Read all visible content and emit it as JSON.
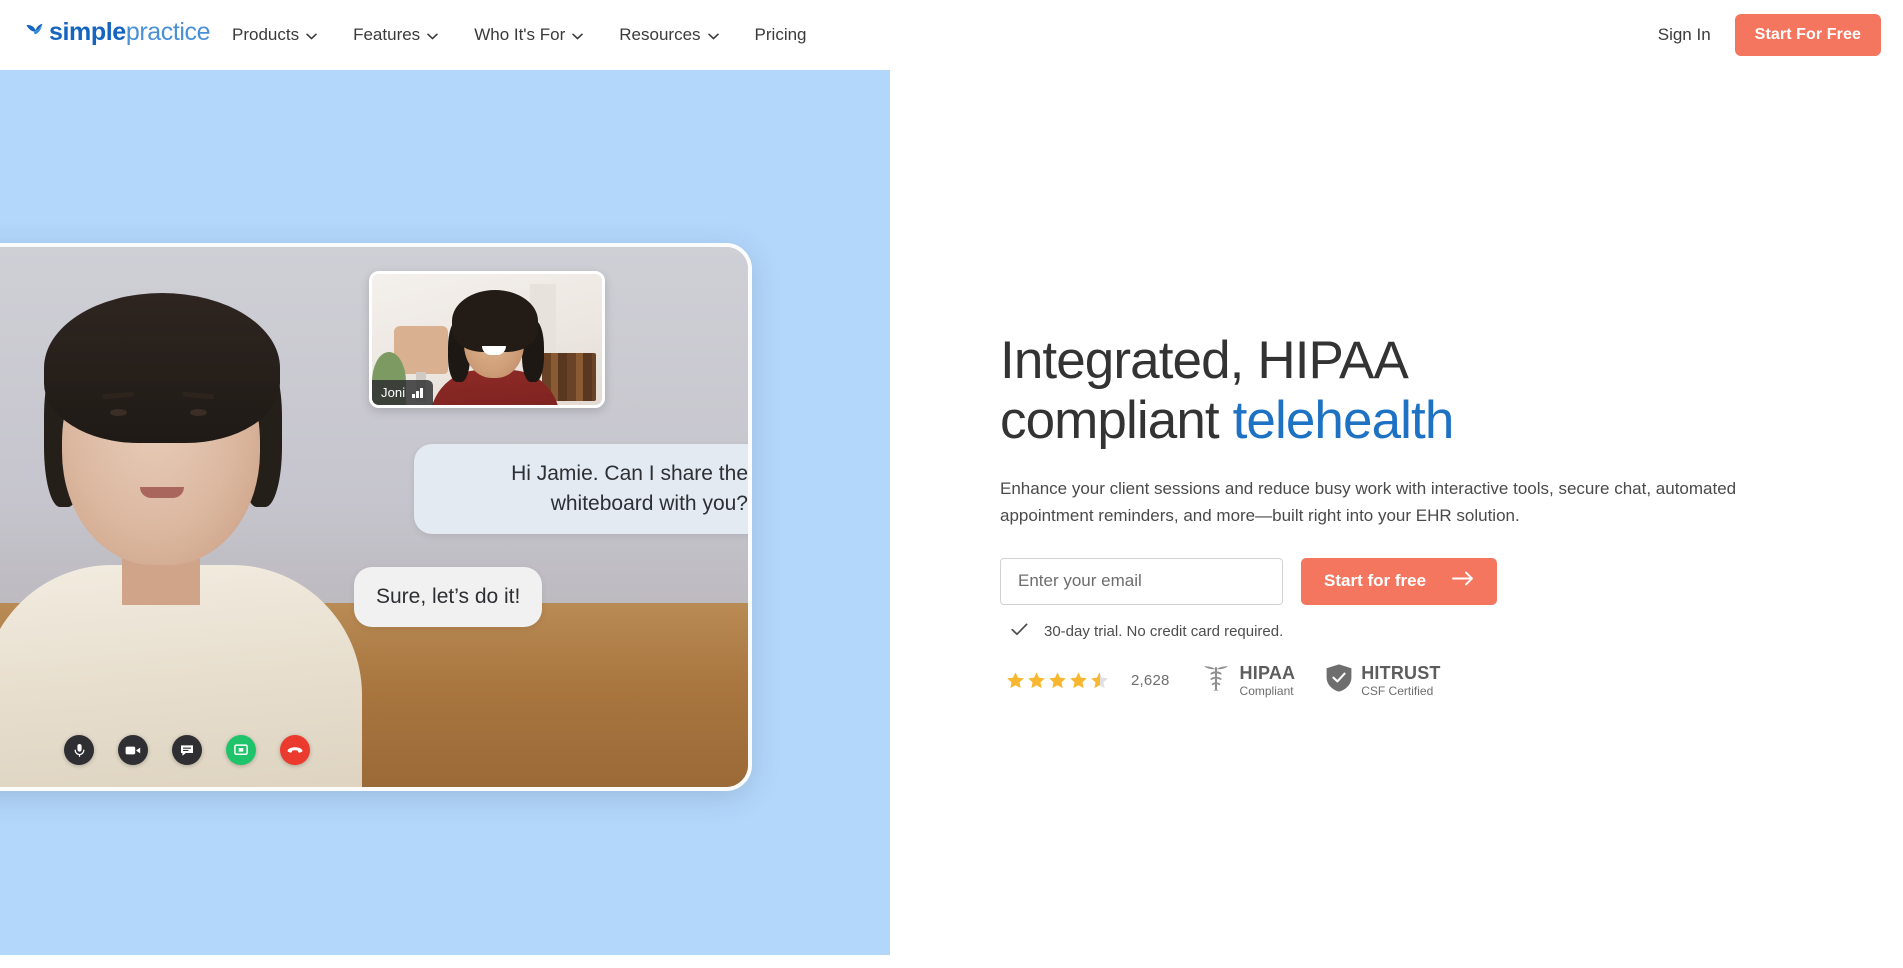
{
  "brand": {
    "logo_text_bold": "simple",
    "logo_text_light": "practice",
    "logo_icon": "butterfly-mark-icon",
    "accent_blue": "#1d72c4",
    "logo_blue": "#1565c0",
    "coral": "#f4765f",
    "panel_blue": "#b3d7fb",
    "star_gold": "#f7b731"
  },
  "nav": {
    "items": [
      {
        "label": "Products",
        "has_dropdown": true,
        "icon": "chevron-down-icon"
      },
      {
        "label": "Features",
        "has_dropdown": true,
        "icon": "chevron-down-icon"
      },
      {
        "label": "Who It's For",
        "has_dropdown": true,
        "icon": "chevron-down-icon"
      },
      {
        "label": "Resources",
        "has_dropdown": true,
        "icon": "chevron-down-icon"
      },
      {
        "label": "Pricing",
        "has_dropdown": false,
        "icon": ""
      }
    ],
    "sign_in": "Sign In",
    "cta": "Start For Free"
  },
  "hero": {
    "headline_part1": "Integrated, HIPAA compliant ",
    "headline_accent": "telehealth",
    "subhead": "Enhance your client sessions and reduce busy work with interactive tools, secure chat, automated appointment reminders, and more—built right into your EHR solution.",
    "email_placeholder": "Enter your email",
    "email_value": "",
    "cta_label": "Start for free",
    "cta_icon": "arrow-right-icon",
    "trial_note": "30-day trial. No credit card required.",
    "trial_icon": "checkmark-icon"
  },
  "trust": {
    "rating_value": 4.5,
    "stars_total": 5,
    "review_count": "2,628",
    "badges": [
      {
        "icon": "caduceus-icon",
        "main": "HIPAA",
        "sub": "Compliant"
      },
      {
        "icon": "shield-check-icon",
        "main": "HITRUST",
        "sub": "CSF Certified"
      }
    ]
  },
  "video_mock": {
    "pip_name": "Joni",
    "pip_signal_icon": "signal-bars-icon",
    "messages": [
      {
        "id": "msg-incoming",
        "text": "Hi Jamie. Can I share the whiteboard with you?"
      },
      {
        "id": "msg-outgoing",
        "text": "Sure, let’s do it!"
      }
    ],
    "controls": [
      {
        "name": "microphone-button",
        "icon": "microphone-icon",
        "style": "dark"
      },
      {
        "name": "camera-button",
        "icon": "video-camera-icon",
        "style": "dark"
      },
      {
        "name": "chat-button",
        "icon": "chat-bubble-icon",
        "style": "dark"
      },
      {
        "name": "share-screen-button",
        "icon": "screen-share-icon",
        "style": "green"
      },
      {
        "name": "end-call-button",
        "icon": "phone-hangup-icon",
        "style": "red"
      }
    ]
  }
}
